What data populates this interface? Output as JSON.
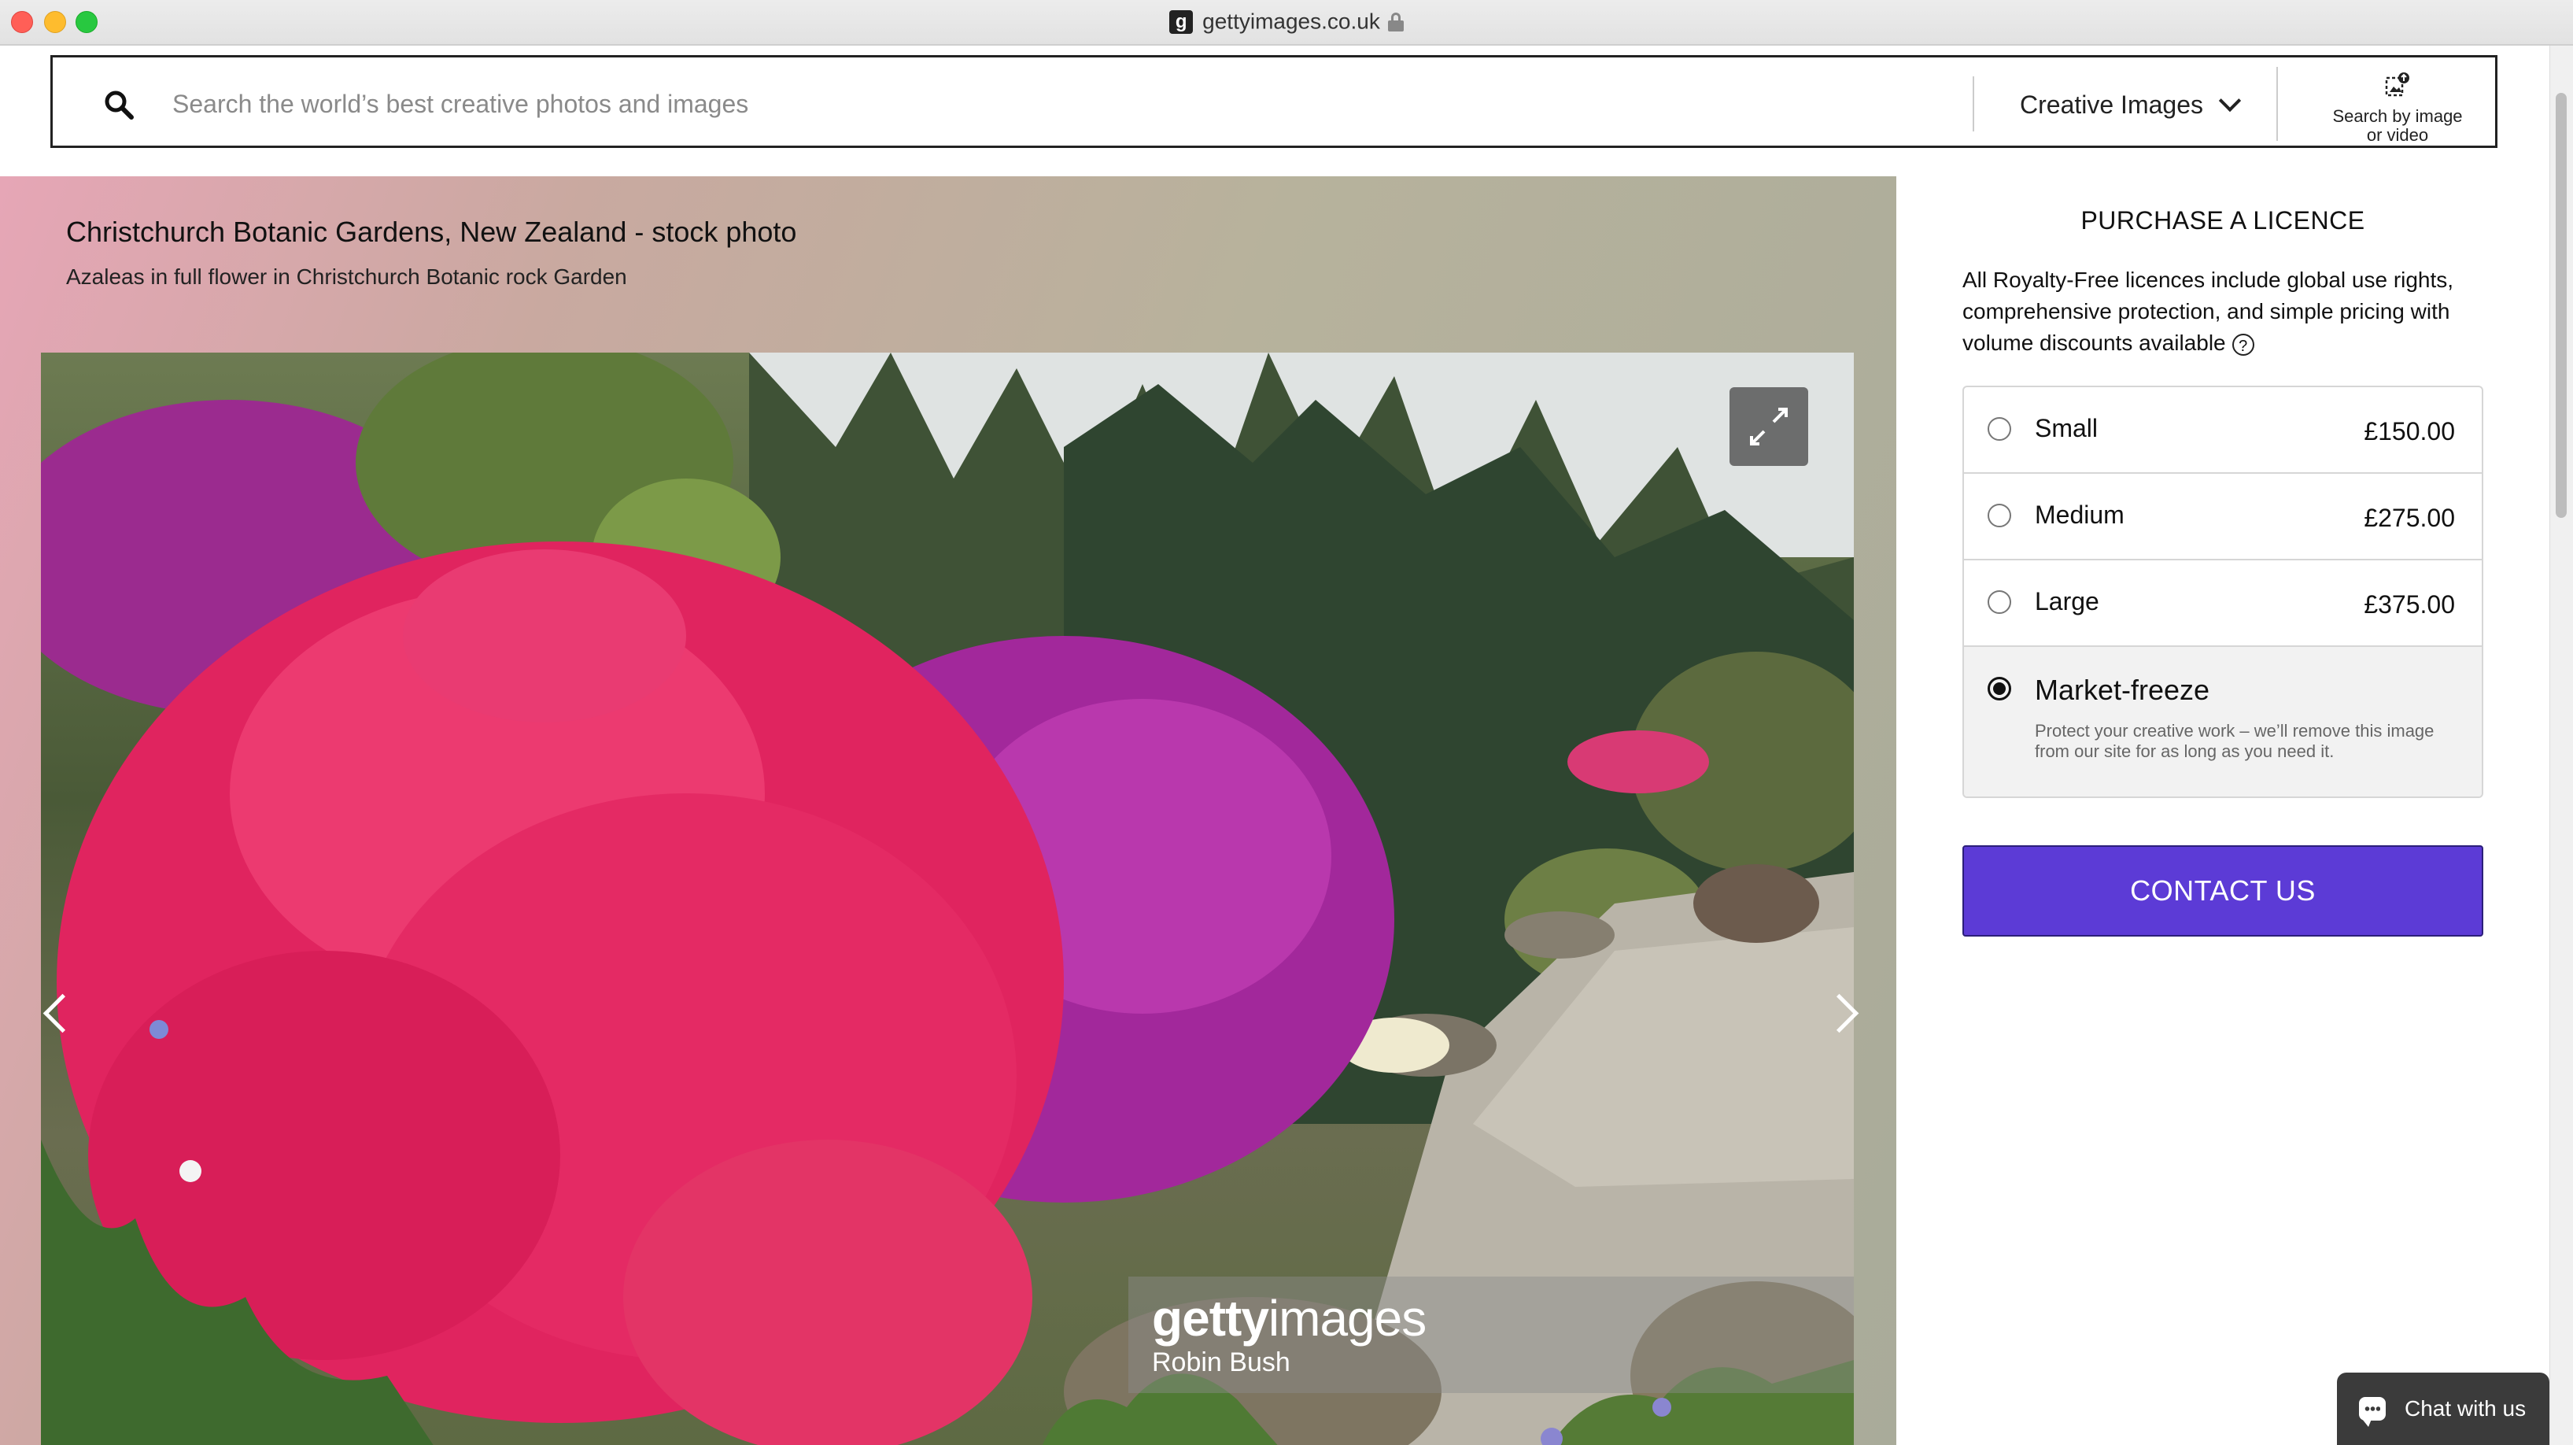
{
  "browser": {
    "domain": "gettyimages.co.uk",
    "favicon_letter": "g"
  },
  "search": {
    "placeholder": "Search the world’s best creative photos and images",
    "value": "",
    "category": "Creative Images",
    "image_search_line1": "Search by image",
    "image_search_line2": "or video"
  },
  "asset": {
    "title": "Christchurch Botanic Gardens, New Zealand - stock photo",
    "caption": "Azaleas in full flower in Christchurch Botanic rock Garden",
    "watermark_brand_bold": "getty",
    "watermark_brand_light": "images",
    "watermark_credit": "Robin Bush"
  },
  "licence": {
    "heading": "PURCHASE A LICENCE",
    "description": "All Royalty-Free licences include global use rights, comprehensive protection, and simple pricing with volume discounts available",
    "help_symbol": "?",
    "options": [
      {
        "label": "Small",
        "price": "£150.00",
        "selected": false
      },
      {
        "label": "Medium",
        "price": "£275.00",
        "selected": false
      },
      {
        "label": "Large",
        "price": "£375.00",
        "selected": false
      }
    ],
    "freeze": {
      "label": "Market-freeze",
      "description": "Protect your creative work – we’ll remove this image from our site for as long as you need it.",
      "selected": true
    },
    "cta": "CONTACT US"
  },
  "chat": {
    "label": "Chat with us"
  },
  "colors": {
    "cta_purple": "#5c3bd6",
    "azalea_pink": "#e8336b",
    "azalea_magenta": "#b42aa6"
  }
}
